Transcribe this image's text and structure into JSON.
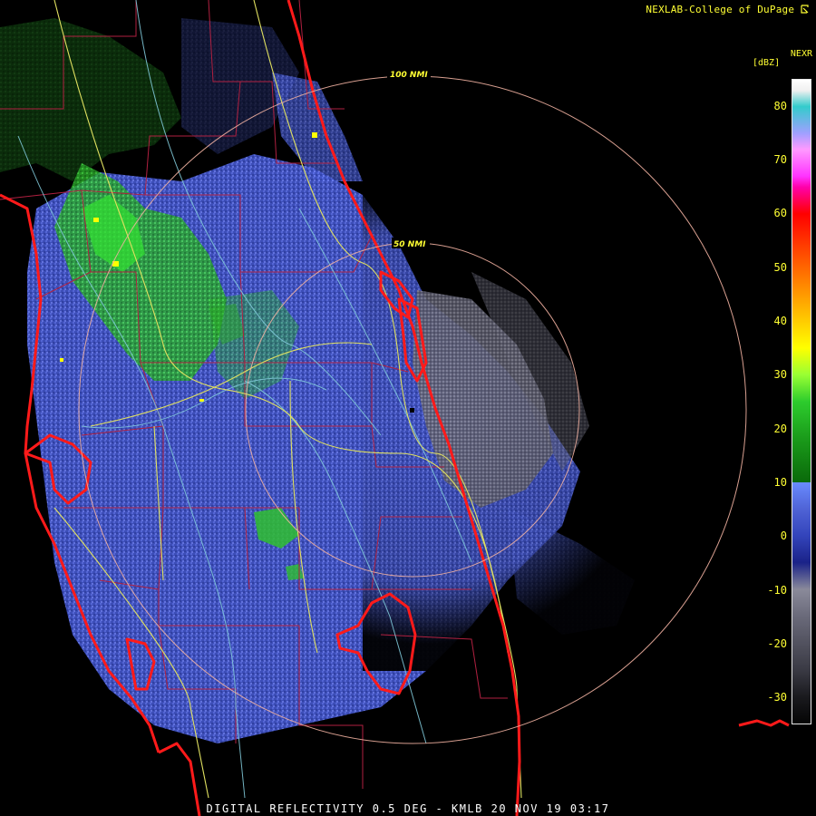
{
  "header": {
    "credit": "NEXLAB-College of DuPage",
    "product": "NEXR",
    "unit": "[dBZ]"
  },
  "rings": [
    {
      "label": "100 NMI"
    },
    {
      "label": "50 NMI"
    }
  ],
  "legend": {
    "ticks": [
      {
        "value": "80"
      },
      {
        "value": "70"
      },
      {
        "value": "60"
      },
      {
        "value": "50"
      },
      {
        "value": "40"
      },
      {
        "value": "30"
      },
      {
        "value": "20"
      },
      {
        "value": "10"
      },
      {
        "value": "0"
      },
      {
        "value": "-10"
      },
      {
        "value": "-20"
      },
      {
        "value": "-30"
      }
    ],
    "range_dbz": [
      -35,
      85
    ],
    "colors": {
      "grey": "#6a6a7a",
      "blue": "#4f63d6",
      "green": "#2dcc2d",
      "yellow": "#ffff00",
      "red": "#ff0000",
      "magenta": "#ff33ff",
      "cyan": "#33cccc"
    }
  },
  "footer": {
    "caption": "DIGITAL REFLECTIVITY 0.5 DEG - KMLB 20 NOV 19 03:17"
  },
  "overlay_colors": {
    "coastline": "#ff1a1a",
    "counties": "#b02040",
    "highways": "#e0e060",
    "roads": "#80c8d8",
    "rings": "#f0b0a0"
  }
}
